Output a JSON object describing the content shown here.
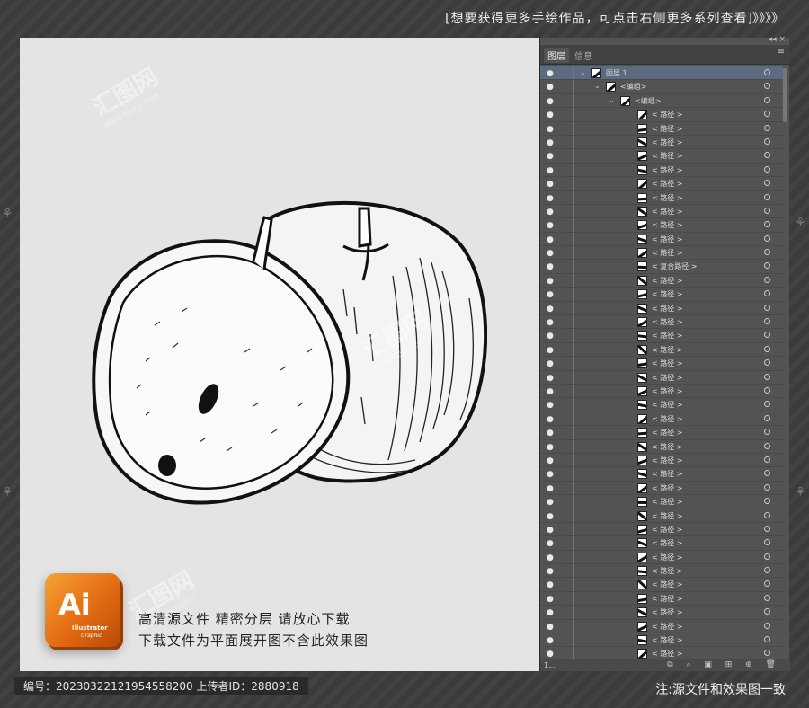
{
  "header": {
    "banner": "[想要获得更多手绘作品，可点击右侧更多系列查看]",
    "arrows": "》》》》"
  },
  "artboard": {
    "logo": {
      "main": "Ai",
      "sub": "Illustrator",
      "sub2": "Graphic"
    },
    "promo_line1": "高清源文件   精密分层   请放心下载",
    "promo_line2": "下载文件为平面展开图不含此效果图"
  },
  "watermark": {
    "text": "汇图网",
    "url": "www.huitu.com"
  },
  "layers_panel": {
    "tabs": [
      {
        "label": "图层",
        "active": true
      },
      {
        "label": "信息",
        "active": false
      }
    ],
    "menu_icon": "≡",
    "window_controls": "◂◂  ×",
    "layer_name": "图层 1",
    "group_name": "<编组>",
    "subgroup_name": "<编组>",
    "paths": [
      "< 路径 >",
      "< 路径 >",
      "< 路径 >",
      "< 路径 >",
      "< 路径 >",
      "< 路径 >",
      "< 路径 >",
      "< 路径 >",
      "< 路径 >",
      "< 路径 >",
      "< 路径 >",
      "< 复合路径 >",
      "< 路径 >",
      "< 路径 >",
      "< 路径 >",
      "< 路径 >",
      "< 路径 >",
      "< 路径 >",
      "< 路径 >",
      "< 路径 >",
      "< 路径 >",
      "< 路径 >",
      "< 路径 >",
      "< 路径 >",
      "< 路径 >",
      "< 路径 >",
      "< 路径 >",
      "< 路径 >",
      "< 路径 >",
      "< 路径 >",
      "< 路径 >",
      "< 路径 >",
      "< 路径 >",
      "< 路径 >",
      "< 路径 >",
      "< 路径 >",
      "< 路径 >",
      "< 路径 >",
      "< 路径 >",
      "< 路径 >"
    ],
    "footer_count": "1...",
    "footer_icons": "⧉ ⌕ ▣ ⊞ ⊕ 🗑"
  },
  "footer": {
    "info": "编号：20230322121954558200  上传者ID：2880918",
    "note": "注:源文件和效果图一致"
  },
  "colors": {
    "selection_bar": "#4b7bd0",
    "logo_orange": "#e36b12",
    "artboard_bg": "#e4e4e4"
  }
}
